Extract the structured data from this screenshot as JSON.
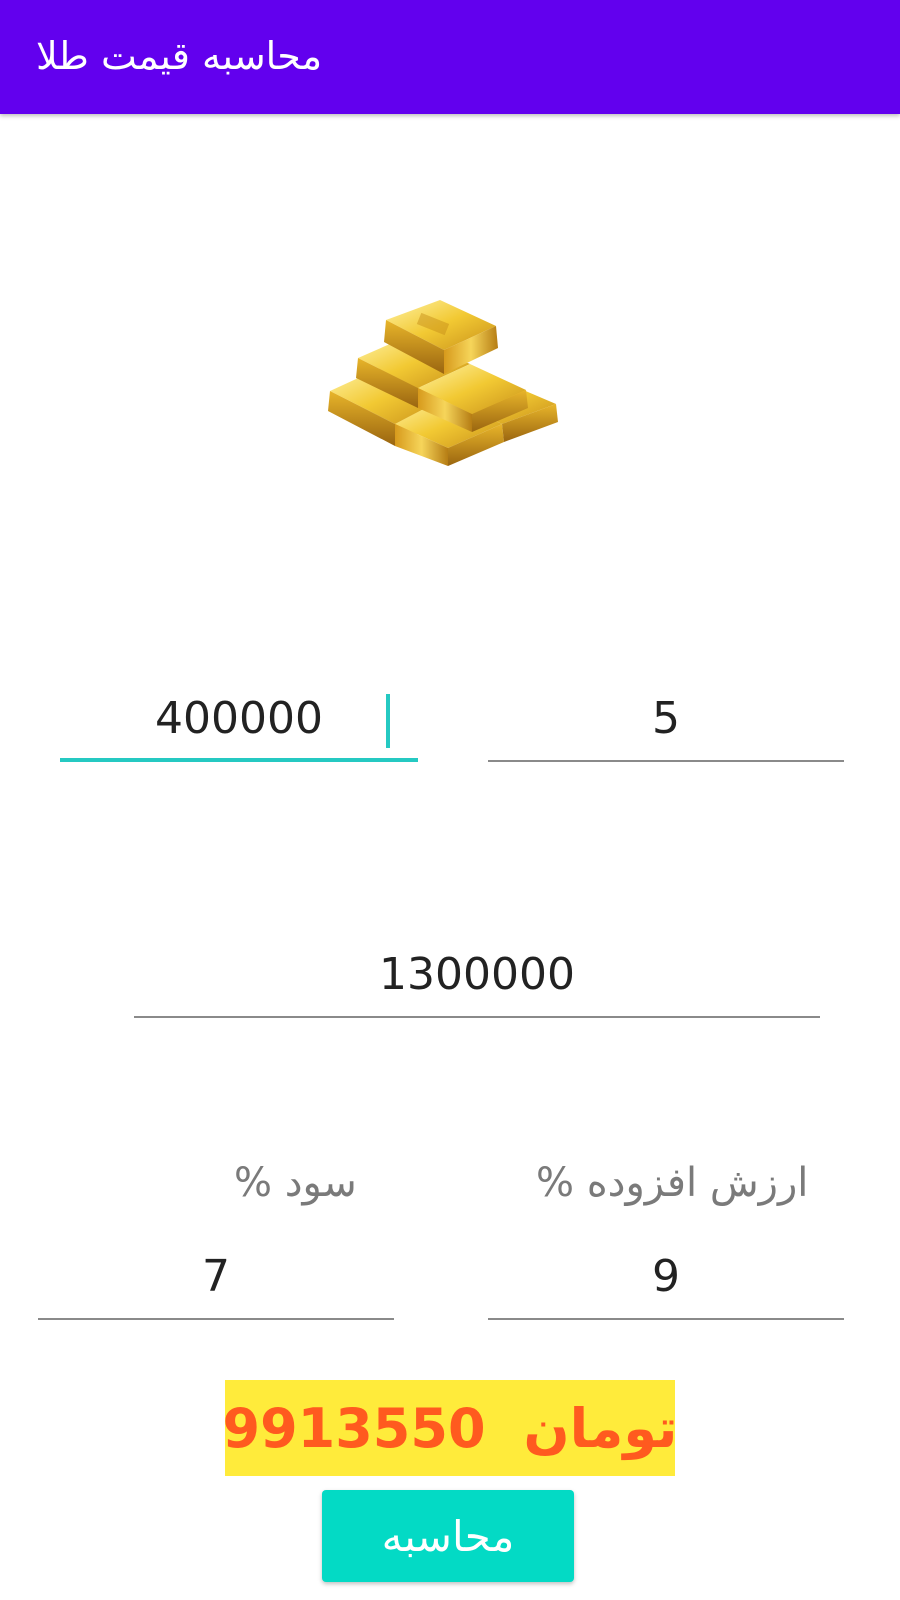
{
  "app_bar": {
    "title": "محاسبه قیمت طلا",
    "color": "#6200ee"
  },
  "image": {
    "name": "gold-bars"
  },
  "inputs": {
    "price_per_gram": {
      "value": "400000",
      "focused": true
    },
    "weight": {
      "value": "5"
    },
    "wage": {
      "value": "1300000"
    },
    "profit": {
      "label": "سود %",
      "value": "7"
    },
    "vat": {
      "label": "ارزش افزوده %",
      "value": "9"
    }
  },
  "result": {
    "amount": "9913550",
    "currency": "تومان",
    "background": "#ffeb3b",
    "text_color": "#ff5a1f"
  },
  "calculate_button": {
    "label": "محاسبه",
    "color": "#03dac5"
  }
}
